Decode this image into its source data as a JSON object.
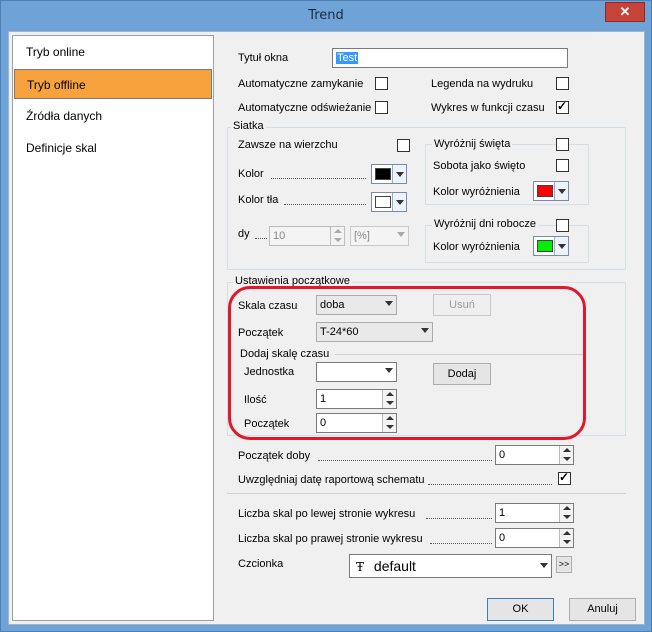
{
  "window": {
    "title": "Trend",
    "close_glyph": "✕"
  },
  "sidebar": {
    "items": [
      {
        "label": "Tryb online",
        "active": false
      },
      {
        "label": "Tryb offline",
        "active": true
      },
      {
        "label": "Źródła danych",
        "active": false
      },
      {
        "label": "Definicje skal",
        "active": false
      }
    ]
  },
  "general": {
    "window_title_label": "Tytuł okna",
    "window_title_value": "Test",
    "auto_close_label": "Automatyczne zamykanie",
    "auto_refresh_label": "Automatyczne odświeżanie",
    "legend_print_label": "Legenda na wydruku",
    "time_chart_label": "Wykres w funkcji czasu",
    "auto_close_checked": false,
    "auto_refresh_checked": false,
    "legend_print_checked": false,
    "time_chart_checked": true
  },
  "grid": {
    "title": "Siatka",
    "always_on_top_label": "Zawsze na wierzchu",
    "color_label": "Kolor",
    "bg_color_label": "Kolor tła",
    "dy_label": "dy",
    "dy_value": "10",
    "dy_unit": "[%]",
    "color_value": "#000000",
    "bg_color_value": "#ffffff",
    "holidays_title": "Wyróżnij święta",
    "saturday_label": "Sobota jako święto",
    "highlight_color_label": "Kolor wyróżnienia",
    "holiday_color": "#ff0000",
    "workdays_title": "Wyróżnij dni robocze",
    "workdays_color_label": "Kolor wyróżnienia",
    "workday_color": "#00ee00"
  },
  "initial": {
    "title": "Ustawienia początkowe",
    "time_scale_label": "Skala czasu",
    "time_scale_value": "doba",
    "remove_button": "Usuń",
    "start_label": "Początek",
    "start_value": "T-24*60",
    "add_scale_title": "Dodaj skalę czasu",
    "unit_label": "Jednostka",
    "unit_value": "",
    "add_button": "Dodaj",
    "count_label": "Ilość",
    "count_value": "1",
    "start2_label": "Początek",
    "start2_value": "0"
  },
  "day": {
    "day_start_label": "Początek doby",
    "day_start_value": "0",
    "report_date_label": "Uwzględniaj datę raportową schematu",
    "report_date_checked": true
  },
  "scales": {
    "left_label": "Liczba skal po lewej stronie wykresu",
    "left_value": "1",
    "right_label": "Liczba skal po prawej stronie wykresu",
    "right_value": "0"
  },
  "font": {
    "label": "Czcionka",
    "value": "default",
    "icon": "font-icon",
    "more_glyph": ">>"
  },
  "footer": {
    "ok_label": "OK",
    "cancel_label": "Anuluj"
  }
}
